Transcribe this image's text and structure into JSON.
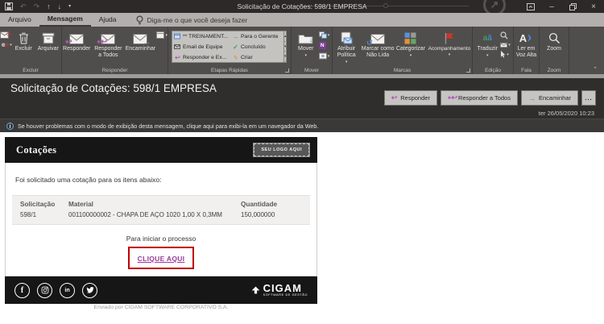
{
  "window": {
    "title": "Solicitação de Cotações: 598/1 EMPRESA"
  },
  "tabs": {
    "arquivo": "Arquivo",
    "mensagem": "Mensagem",
    "ajuda": "Ajuda",
    "tell_me": "Diga-me o que você deseja fazer"
  },
  "ribbon": {
    "excluir": {
      "label": "Excluir",
      "excluir": "Excluir",
      "arquivar": "Arquivar"
    },
    "responder": {
      "label": "Responder",
      "responder": "Responder",
      "responder_todos": "Responder a Todos",
      "encaminhar": "Encaminhar"
    },
    "etapas": {
      "label": "Etapas Rápidas",
      "items": [
        {
          "label": "** TREINAMENT..."
        },
        {
          "label": "Email de Equipe"
        },
        {
          "label": "Responder e Ex..."
        },
        {
          "label": "Para o Gerente"
        },
        {
          "label": "Concluído"
        },
        {
          "label": "Criar"
        }
      ]
    },
    "mover": {
      "label": "Mover",
      "mover": "Mover",
      "onenote_glyph": "N"
    },
    "marcas": {
      "label": "Marcas",
      "atribuir": "Atribuir Política",
      "nao_lida": "Marcar como Não Lida",
      "categorizar": "Categorizar",
      "acompanhamento": "Acompanhamento"
    },
    "edicao": {
      "label": "Edição",
      "traduzir": "Traduzir"
    },
    "fala": {
      "label": "Fala",
      "ler": "Ler em Voz Alta"
    },
    "zoom": {
      "label": "Zoom",
      "zoom": "Zoom"
    }
  },
  "header": {
    "subject": "Solicitação de Cotações: 598/1 EMPRESA",
    "responder": "Responder",
    "responder_todos": "Responder a Todos",
    "encaminhar": "Encaminhar",
    "more": "...",
    "date": "ter 26/05/2020 10:23",
    "info": "Se houver problemas com o modo de exibição desta mensagem, clique aqui para exibi-la em um navegador da Web."
  },
  "email": {
    "title": "Cotações",
    "logo_placeholder": "SEU LOGO AQUI",
    "intro": "Foi solicitado uma cotação para os itens abaixo:",
    "table": {
      "headers": [
        "Solicitação",
        "Material",
        "Quantidade"
      ],
      "rows": [
        [
          "598/1",
          "001100000002 - CHAPA DE AÇO 1020 1,00 X 0,3MM",
          "150,000000"
        ]
      ]
    },
    "process": "Para iniciar o processo",
    "cta": "CLIQUE AQUI",
    "social": {
      "facebook": "f",
      "linkedin": "in"
    },
    "brand": {
      "name": "CIGAM",
      "tagline": "SOFTWARE DE GESTÃO"
    },
    "sent_by": "Enviado por CIGAM SOFTWARE CORPORATIVO S.A."
  },
  "colors": {
    "accent_purple": "#9b3a9b",
    "cta_border": "#c00000",
    "info_blue": "#5aa7e0"
  }
}
